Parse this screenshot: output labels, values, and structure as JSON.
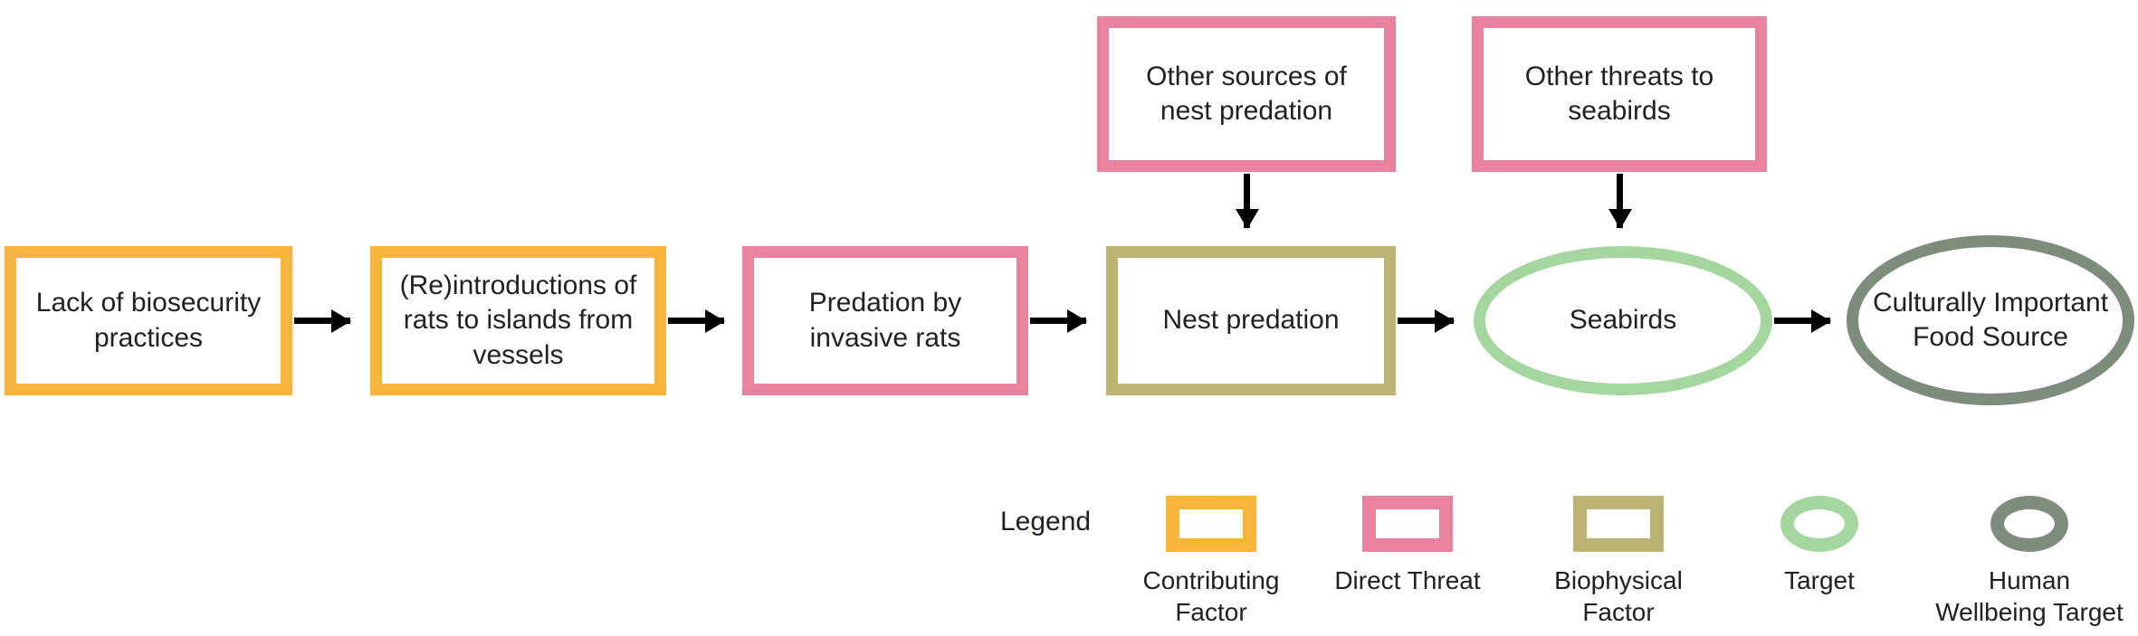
{
  "colors": {
    "contributing_factor": "#F9B43C",
    "direct_threat": "#E8829F",
    "biophysical_factor": "#BDB473",
    "target": "#A5D6A0",
    "human_wellbeing_target": "#7E8C7D",
    "arrow": "#000000",
    "text": "#202124",
    "background": "#FFFFFF"
  },
  "nodes": {
    "lack_of_biosecurity": {
      "label": "Lack of biosecurity practices",
      "type": "Contributing Factor",
      "shape": "rectangle"
    },
    "reintroductions": {
      "label": "(Re)introductions of rats to islands from vessels",
      "type": "Contributing Factor",
      "shape": "rectangle"
    },
    "predation_invasive_rats": {
      "label": "Predation by invasive rats",
      "type": "Direct Threat",
      "shape": "rectangle"
    },
    "nest_predation": {
      "label": "Nest predation",
      "type": "Biophysical Factor",
      "shape": "rectangle"
    },
    "seabirds": {
      "label": "Seabirds",
      "type": "Target",
      "shape": "ellipse"
    },
    "culturally_important_food_source": {
      "label": "Culturally Important Food Source",
      "type": "Human Wellbeing Target",
      "shape": "ellipse"
    },
    "other_sources_nest_predation": {
      "label": "Other sources of nest predation",
      "type": "Direct Threat",
      "shape": "rectangle"
    },
    "other_threats_seabirds": {
      "label": "Other threats to seabirds",
      "type": "Direct Threat",
      "shape": "rectangle"
    }
  },
  "legend": {
    "title": "Legend",
    "items": [
      {
        "label": "Contributing\nFactor",
        "color": "#F9B43C",
        "shape": "rectangle"
      },
      {
        "label": "Direct Threat",
        "color": "#E8829F",
        "shape": "rectangle"
      },
      {
        "label": "Biophysical\nFactor",
        "color": "#BDB473",
        "shape": "rectangle"
      },
      {
        "label": "Target",
        "color": "#A5D6A0",
        "shape": "ellipse"
      },
      {
        "label": "Human\nWellbeing Target",
        "color": "#7E8C7D",
        "shape": "ellipse"
      }
    ]
  },
  "edges": [
    {
      "from": "lack_of_biosecurity",
      "to": "reintroductions",
      "direction": "right"
    },
    {
      "from": "reintroductions",
      "to": "predation_invasive_rats",
      "direction": "right"
    },
    {
      "from": "predation_invasive_rats",
      "to": "nest_predation",
      "direction": "right"
    },
    {
      "from": "nest_predation",
      "to": "seabirds",
      "direction": "right"
    },
    {
      "from": "seabirds",
      "to": "culturally_important_food_source",
      "direction": "right"
    },
    {
      "from": "other_sources_nest_predation",
      "to": "nest_predation",
      "direction": "down"
    },
    {
      "from": "other_threats_seabirds",
      "to": "seabirds",
      "direction": "down"
    }
  ]
}
